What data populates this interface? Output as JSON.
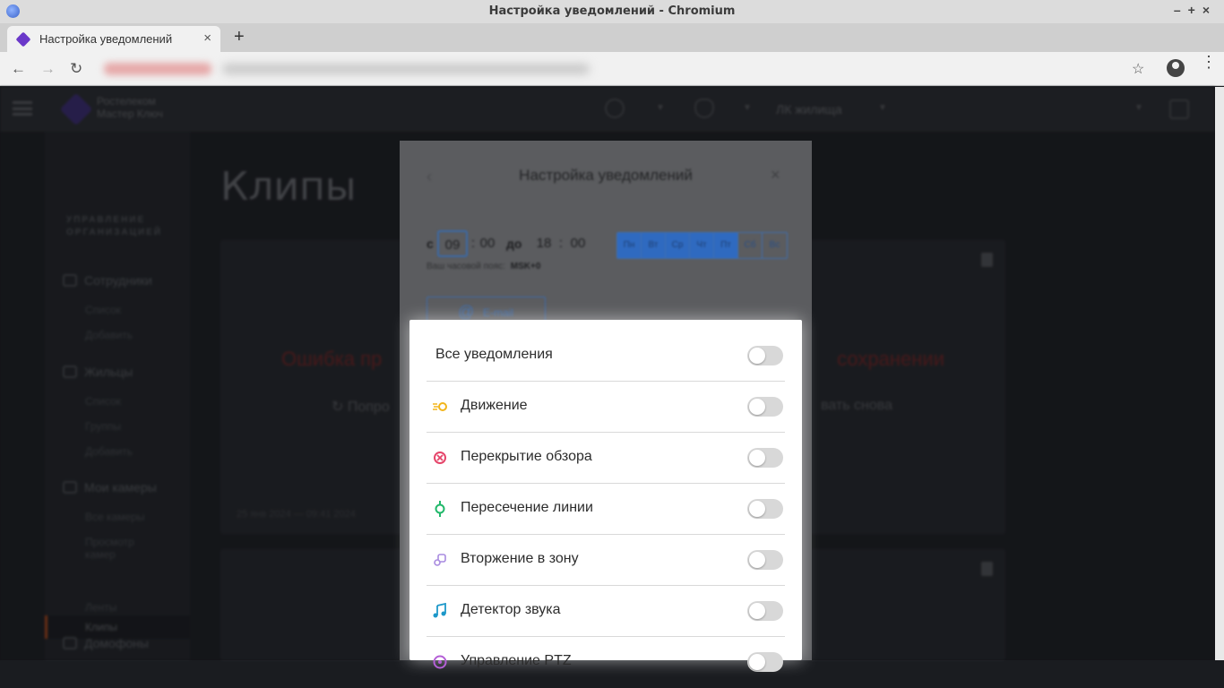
{
  "browser": {
    "window_title": "Настройка уведомлений - Chromium",
    "tab_title": "Настройка уведомлений",
    "tab_close": "×",
    "new_tab": "+",
    "back": "←",
    "forward": "→",
    "reload": "↻",
    "bookmark": "☆",
    "menu": "⋮"
  },
  "app": {
    "logo_line1": "Ростелеком",
    "logo_line2": "Мастер Ключ",
    "header_account": "ЛК жилища",
    "page_title": "Клипы",
    "sidebar": {
      "group_title_line1": "УПРАВЛЕНИЕ",
      "group_title_line2": "ОРГАНИЗАЦИЕЙ",
      "sections": [
        {
          "label": "Сотрудники",
          "items": [
            "Список",
            "Добавить"
          ]
        },
        {
          "label": "Жильцы",
          "items": [
            "Список",
            "Группы",
            "Добавить"
          ]
        },
        {
          "label": "Мои камеры",
          "items": [
            "Все камеры",
            "Просмотр камер",
            "Клипы",
            "Ленты"
          ]
        },
        {
          "label": "Домофоны",
          "items": []
        }
      ],
      "active_item": "Клипы"
    },
    "cards": [
      {
        "error_left": "Ошибка пр",
        "error_right": "сохранении",
        "retry_left": "Попро",
        "retry_right": "вать снова",
        "meta": "25 янв 2024 — 09:41 2024"
      },
      {
        "error_left": "",
        "error_right": "",
        "retry_left": "",
        "retry_right": "",
        "meta": ""
      }
    ]
  },
  "modal": {
    "back_icon": "‹",
    "title": "Настройка уведомлений",
    "close_icon": "×",
    "from_label": "с",
    "from_hour": "09",
    "from_minute": "00",
    "to_label": "до",
    "to_hour": "18",
    "to_minute": "00",
    "separator": ":",
    "days": [
      {
        "label": "Пн",
        "on": true
      },
      {
        "label": "Вт",
        "on": true
      },
      {
        "label": "Ср",
        "on": true
      },
      {
        "label": "Чт",
        "on": true
      },
      {
        "label": "Пт",
        "on": true
      },
      {
        "label": "Сб",
        "on": false
      },
      {
        "label": "Вс",
        "on": false
      }
    ],
    "timezone_label": "Ваш часовой пояс:",
    "timezone_value": "MSK+0",
    "email_label": "E-mail",
    "email_icon": "@"
  },
  "notifications": {
    "all_label": "Все уведомления",
    "items": [
      {
        "label": "Движение",
        "icon": "motion-icon",
        "color": "#f2b51b",
        "enabled": false
      },
      {
        "label": "Перекрытие обзора",
        "icon": "blocked-view-icon",
        "color": "#e5456a",
        "enabled": false
      },
      {
        "label": "Пересечение линии",
        "icon": "line-crossing-icon",
        "color": "#21b86a",
        "enabled": false
      },
      {
        "label": "Вторжение в зону",
        "icon": "zone-intrusion-icon",
        "color": "#a98be0",
        "enabled": false
      },
      {
        "label": "Детектор звука",
        "icon": "sound-detector-icon",
        "color": "#1d98c9",
        "enabled": false
      },
      {
        "label": "Управление PTZ",
        "icon": "ptz-icon",
        "color": "#b45fd6",
        "enabled": false
      }
    ]
  }
}
